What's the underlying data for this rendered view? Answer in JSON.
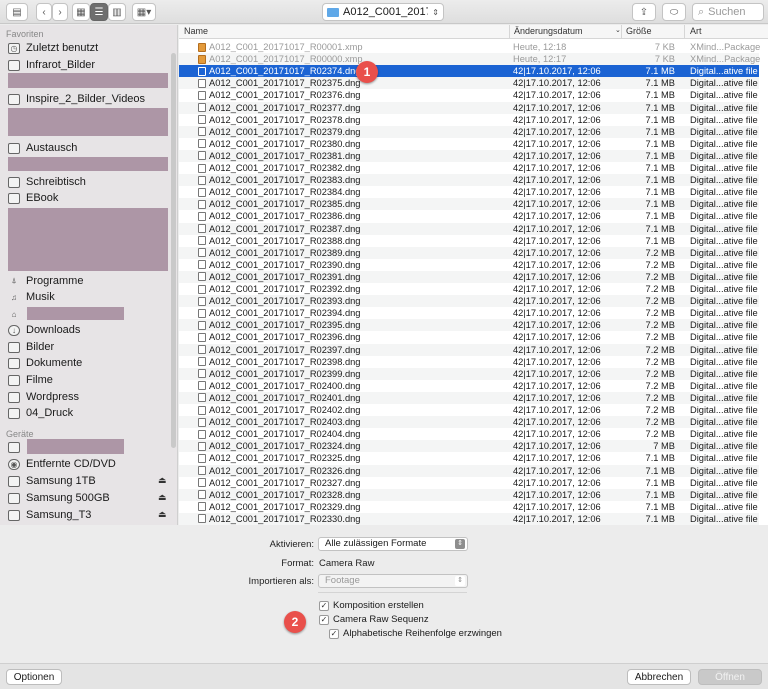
{
  "toolbar": {
    "location": "A012_C001_201710...",
    "search_placeholder": "Suchen"
  },
  "sidebar": {
    "favorites_header": "Favoriten",
    "devices_header": "Geräte",
    "items": [
      {
        "label": "Zuletzt benutzt",
        "icon": "recent-icon"
      },
      {
        "label": "Infrarot_Bilder",
        "icon": "folder-icon"
      },
      {
        "label": "Inspire_2_Bilder_Videos",
        "icon": "folder-icon"
      },
      {
        "label": "Austausch",
        "icon": "folder-icon"
      },
      {
        "label": "Schreibtisch",
        "icon": "desktop-icon"
      },
      {
        "label": "EBook",
        "icon": "folder-icon"
      },
      {
        "label": "Programme",
        "icon": "applications-icon"
      },
      {
        "label": "Musik",
        "icon": "music-icon"
      },
      {
        "label": "Downloads",
        "icon": "downloads-icon"
      },
      {
        "label": "Bilder",
        "icon": "pictures-icon"
      },
      {
        "label": "Dokumente",
        "icon": "documents-icon"
      },
      {
        "label": "Filme",
        "icon": "movies-icon"
      },
      {
        "label": "Wordpress",
        "icon": "folder-icon"
      },
      {
        "label": "04_Druck",
        "icon": "folder-icon"
      }
    ],
    "devices": [
      {
        "label": "Entfernte CD/DVD",
        "icon": "disc-icon"
      },
      {
        "label": "Samsung 1TB",
        "icon": "drive-icon"
      },
      {
        "label": "Samsung 500GB",
        "icon": "drive-icon"
      },
      {
        "label": "Samsung_T3",
        "icon": "drive-icon"
      }
    ]
  },
  "list": {
    "columns": {
      "name": "Name",
      "date": "Änderungsdatum",
      "size": "Größe",
      "kind": "Art"
    },
    "rows": [
      [
        "A012_C001_20171017_R00001.xmp",
        "Heute, 12:18",
        "7 KB",
        "XMind...Package"
      ],
      [
        "A012_C001_20171017_R00000.xmp",
        "Heute, 12:17",
        "7 KB",
        "XMind...Package"
      ],
      [
        "A012_C001_20171017_R02374.dng",
        "42|17.10.2017, 12:06",
        "7.1 MB",
        "Digital...ative file"
      ],
      [
        "A012_C001_20171017_R02375.dng",
        "42|17.10.2017, 12:06",
        "7.1 MB",
        "Digital...ative file"
      ],
      [
        "A012_C001_20171017_R02376.dng",
        "42|17.10.2017, 12:06",
        "7.1 MB",
        "Digital...ative file"
      ],
      [
        "A012_C001_20171017_R02377.dng",
        "42|17.10.2017, 12:06",
        "7.1 MB",
        "Digital...ative file"
      ],
      [
        "A012_C001_20171017_R02378.dng",
        "42|17.10.2017, 12:06",
        "7.1 MB",
        "Digital...ative file"
      ],
      [
        "A012_C001_20171017_R02379.dng",
        "42|17.10.2017, 12:06",
        "7.1 MB",
        "Digital...ative file"
      ],
      [
        "A012_C001_20171017_R02380.dng",
        "42|17.10.2017, 12:06",
        "7.1 MB",
        "Digital...ative file"
      ],
      [
        "A012_C001_20171017_R02381.dng",
        "42|17.10.2017, 12:06",
        "7.1 MB",
        "Digital...ative file"
      ],
      [
        "A012_C001_20171017_R02382.dng",
        "42|17.10.2017, 12:06",
        "7.1 MB",
        "Digital...ative file"
      ],
      [
        "A012_C001_20171017_R02383.dng",
        "42|17.10.2017, 12:06",
        "7.1 MB",
        "Digital...ative file"
      ],
      [
        "A012_C001_20171017_R02384.dng",
        "42|17.10.2017, 12:06",
        "7.1 MB",
        "Digital...ative file"
      ],
      [
        "A012_C001_20171017_R02385.dng",
        "42|17.10.2017, 12:06",
        "7.1 MB",
        "Digital...ative file"
      ],
      [
        "A012_C001_20171017_R02386.dng",
        "42|17.10.2017, 12:06",
        "7.1 MB",
        "Digital...ative file"
      ],
      [
        "A012_C001_20171017_R02387.dng",
        "42|17.10.2017, 12:06",
        "7.1 MB",
        "Digital...ative file"
      ],
      [
        "A012_C001_20171017_R02388.dng",
        "42|17.10.2017, 12:06",
        "7.1 MB",
        "Digital...ative file"
      ],
      [
        "A012_C001_20171017_R02389.dng",
        "42|17.10.2017, 12:06",
        "7.2 MB",
        "Digital...ative file"
      ],
      [
        "A012_C001_20171017_R02390.dng",
        "42|17.10.2017, 12:06",
        "7.2 MB",
        "Digital...ative file"
      ],
      [
        "A012_C001_20171017_R02391.dng",
        "42|17.10.2017, 12:06",
        "7.2 MB",
        "Digital...ative file"
      ],
      [
        "A012_C001_20171017_R02392.dng",
        "42|17.10.2017, 12:06",
        "7.2 MB",
        "Digital...ative file"
      ],
      [
        "A012_C001_20171017_R02393.dng",
        "42|17.10.2017, 12:06",
        "7.2 MB",
        "Digital...ative file"
      ],
      [
        "A012_C001_20171017_R02394.dng",
        "42|17.10.2017, 12:06",
        "7.2 MB",
        "Digital...ative file"
      ],
      [
        "A012_C001_20171017_R02395.dng",
        "42|17.10.2017, 12:06",
        "7.2 MB",
        "Digital...ative file"
      ],
      [
        "A012_C001_20171017_R02396.dng",
        "42|17.10.2017, 12:06",
        "7.2 MB",
        "Digital...ative file"
      ],
      [
        "A012_C001_20171017_R02397.dng",
        "42|17.10.2017, 12:06",
        "7.2 MB",
        "Digital...ative file"
      ],
      [
        "A012_C001_20171017_R02398.dng",
        "42|17.10.2017, 12:06",
        "7.2 MB",
        "Digital...ative file"
      ],
      [
        "A012_C001_20171017_R02399.dng",
        "42|17.10.2017, 12:06",
        "7.2 MB",
        "Digital...ative file"
      ],
      [
        "A012_C001_20171017_R02400.dng",
        "42|17.10.2017, 12:06",
        "7.2 MB",
        "Digital...ative file"
      ],
      [
        "A012_C001_20171017_R02401.dng",
        "42|17.10.2017, 12:06",
        "7.2 MB",
        "Digital...ative file"
      ],
      [
        "A012_C001_20171017_R02402.dng",
        "42|17.10.2017, 12:06",
        "7.2 MB",
        "Digital...ative file"
      ],
      [
        "A012_C001_20171017_R02403.dng",
        "42|17.10.2017, 12:06",
        "7.2 MB",
        "Digital...ative file"
      ],
      [
        "A012_C001_20171017_R02404.dng",
        "42|17.10.2017, 12:06",
        "7.2 MB",
        "Digital...ative file"
      ],
      [
        "A012_C001_20171017_R02324.dng",
        "42|17.10.2017, 12:06",
        "7 MB",
        "Digital...ative file"
      ],
      [
        "A012_C001_20171017_R02325.dng",
        "42|17.10.2017, 12:06",
        "7.1 MB",
        "Digital...ative file"
      ],
      [
        "A012_C001_20171017_R02326.dng",
        "42|17.10.2017, 12:06",
        "7.1 MB",
        "Digital...ative file"
      ],
      [
        "A012_C001_20171017_R02327.dng",
        "42|17.10.2017, 12:06",
        "7.1 MB",
        "Digital...ative file"
      ],
      [
        "A012_C001_20171017_R02328.dng",
        "42|17.10.2017, 12:06",
        "7.1 MB",
        "Digital...ative file"
      ],
      [
        "A012_C001_20171017_R02329.dng",
        "42|17.10.2017, 12:06",
        "7.1 MB",
        "Digital...ative file"
      ],
      [
        "A012_C001_20171017_R02330.dng",
        "42|17.10.2017, 12:06",
        "7.1 MB",
        "Digital...ative file"
      ]
    ]
  },
  "options": {
    "enable_label": "Aktivieren:",
    "enable_value": "Alle zulässigen Formate",
    "format_label": "Format:",
    "format_value": "Camera Raw",
    "import_as_label": "Importieren als:",
    "import_as_value": "Footage",
    "checkbox_composition": "Komposition erstellen",
    "checkbox_sequence": "Camera Raw Sequenz",
    "checkbox_alpha": "Alphabetische Reihenfolge erzwingen"
  },
  "badges": {
    "one": "1",
    "two": "2"
  },
  "bottom": {
    "options_button": "Optionen",
    "cancel_button": "Abbrechen",
    "open_button": "Öffnen"
  },
  "colors": {
    "selection": "#1b63d3",
    "badge": "#e9504b",
    "redaction": "#ad96a6"
  }
}
